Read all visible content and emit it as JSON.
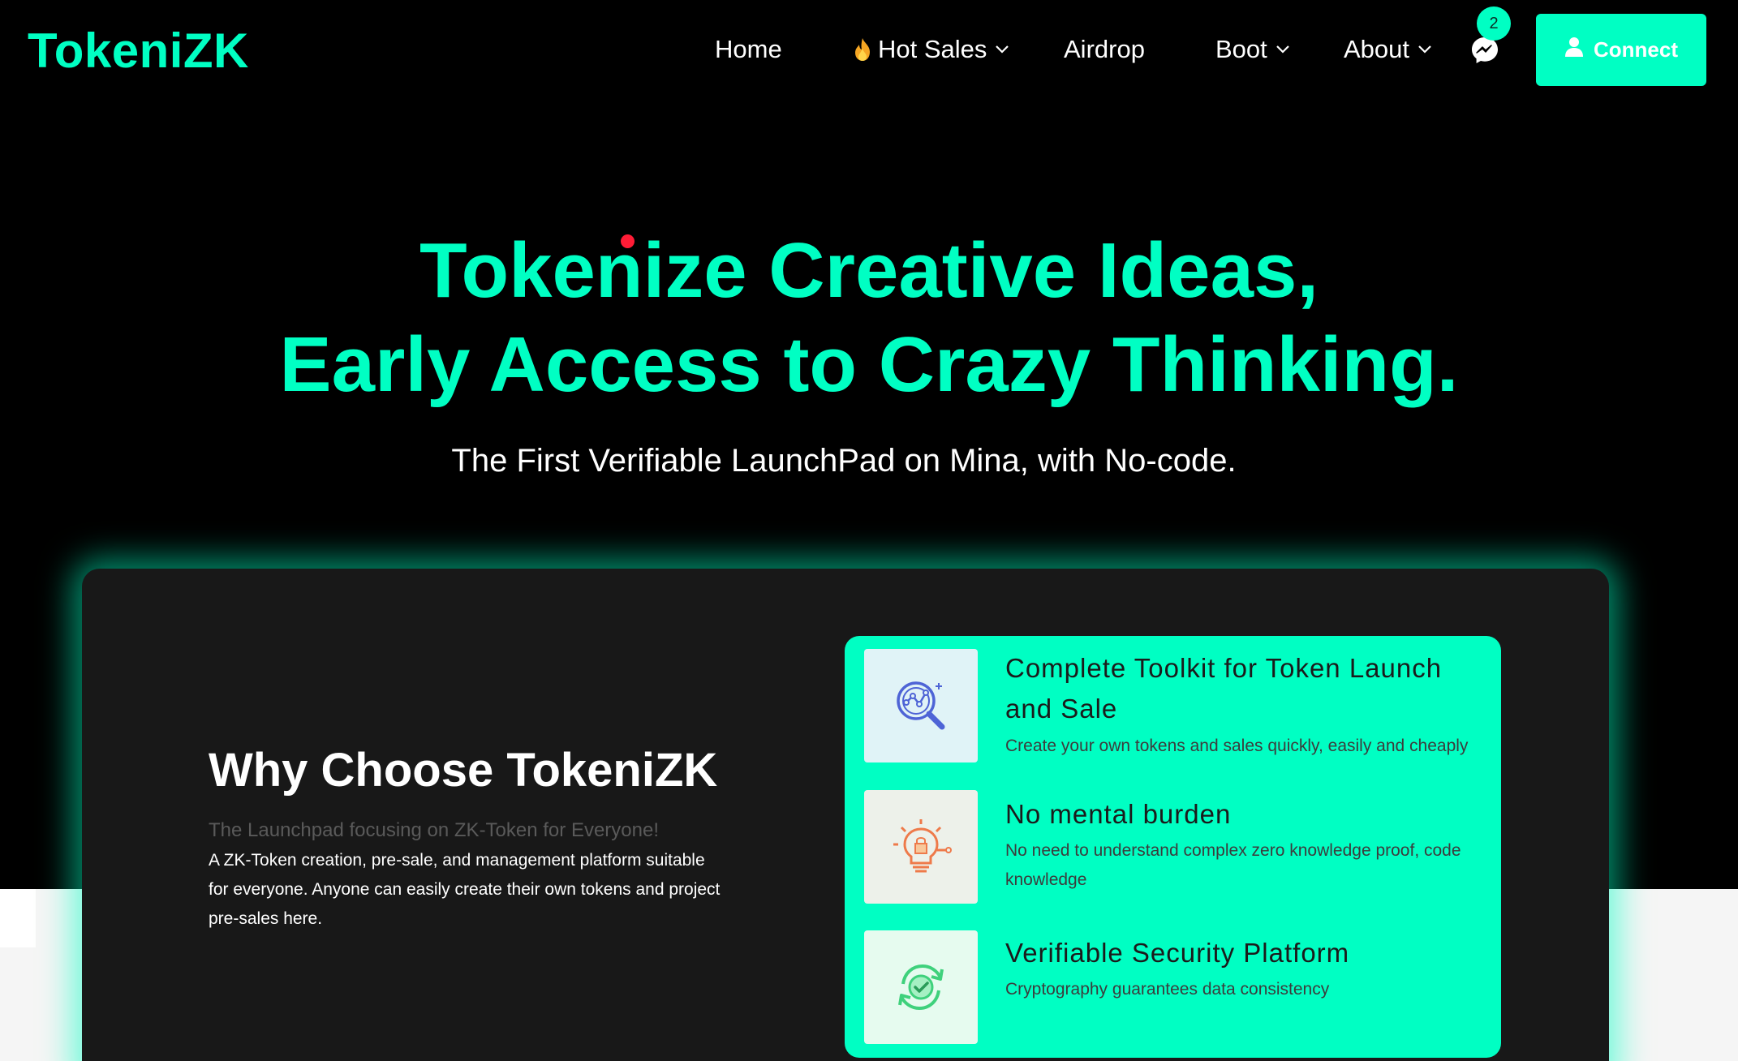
{
  "header": {
    "logo": "TokeniZK",
    "nav": [
      {
        "label": "Home",
        "has_dropdown": false,
        "icon": null
      },
      {
        "label": "Hot Sales",
        "has_dropdown": true,
        "icon": "flame-icon"
      },
      {
        "label": "Airdrop",
        "has_dropdown": false,
        "icon": null
      },
      {
        "label": "Boot",
        "has_dropdown": true,
        "icon": null
      },
      {
        "label": "About",
        "has_dropdown": true,
        "icon": null
      }
    ],
    "messenger_badge": "2",
    "connect_label": "Connect"
  },
  "hero": {
    "title_line1": "Tokenize Creative Ideas,",
    "title_line2": "Early Access to Crazy Thinking.",
    "subtitle": "The First Verifiable LaunchPad on Mina, with No-code."
  },
  "why": {
    "title": "Why Choose TokeniZK",
    "kicker": "The Launchpad focusing on ZK-Token for Everyone!",
    "body": "A ZK-Token creation, pre-sale, and management platform suitable for everyone. Anyone can easily create their own tokens and project pre-sales here."
  },
  "features": [
    {
      "icon": "analytics-magnifier-icon",
      "title": "Complete Toolkit for Token Launch and Sale",
      "desc": "Create your own tokens and sales quickly, easily and cheaply"
    },
    {
      "icon": "lightbulb-lock-icon",
      "title": "No mental burden",
      "desc": "No need to understand complex zero knowledge proof, code knowledge"
    },
    {
      "icon": "refresh-check-icon",
      "title": "Verifiable Security Platform",
      "desc": "Cryptography guarantees data consistency"
    }
  ],
  "colors": {
    "accent": "#00ffc3",
    "background": "#000000",
    "card": "#181818",
    "dot": "#ff1c36"
  }
}
